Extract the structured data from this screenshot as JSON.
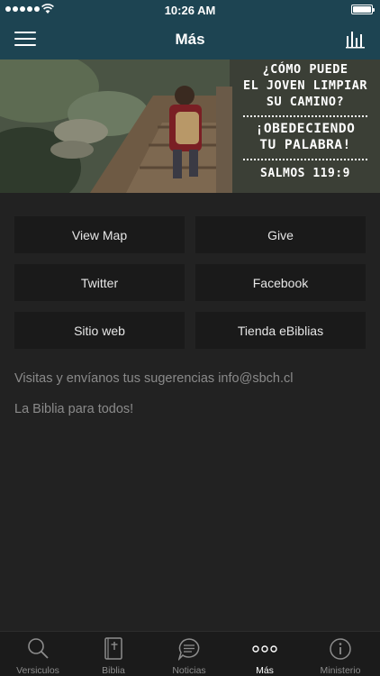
{
  "status_bar": {
    "time": "10:26 AM"
  },
  "header": {
    "title": "Más"
  },
  "banner": {
    "question": [
      "¿CÓMO PUEDE",
      "EL JOVEN LIMPIAR",
      "SU CAMINO?"
    ],
    "answer": [
      "¡OBEDECIENDO",
      "TU PALABRA!"
    ],
    "reference": "SALMOS 119:9"
  },
  "buttons": [
    {
      "label": "View Map"
    },
    {
      "label": "Give"
    },
    {
      "label": "Twitter"
    },
    {
      "label": "Facebook"
    },
    {
      "label": "Sitio web"
    },
    {
      "label": "Tienda eBiblias"
    }
  ],
  "info": {
    "contact": "Visitas y envíanos tus sugerencias info@sbch.cl",
    "slogan": "La Biblia para todos!"
  },
  "tabs": [
    {
      "label": "Versiculos",
      "icon": "search-icon",
      "active": false
    },
    {
      "label": "Biblia",
      "icon": "bible-icon",
      "active": false
    },
    {
      "label": "Noticias",
      "icon": "news-icon",
      "active": false
    },
    {
      "label": "Más",
      "icon": "more-icon",
      "active": true
    },
    {
      "label": "Ministerio",
      "icon": "info-icon",
      "active": false
    }
  ],
  "colors": {
    "header": "#1d4452",
    "background": "#222222",
    "button": "#1a1a1a",
    "tabbar": "#1b1b1b"
  }
}
